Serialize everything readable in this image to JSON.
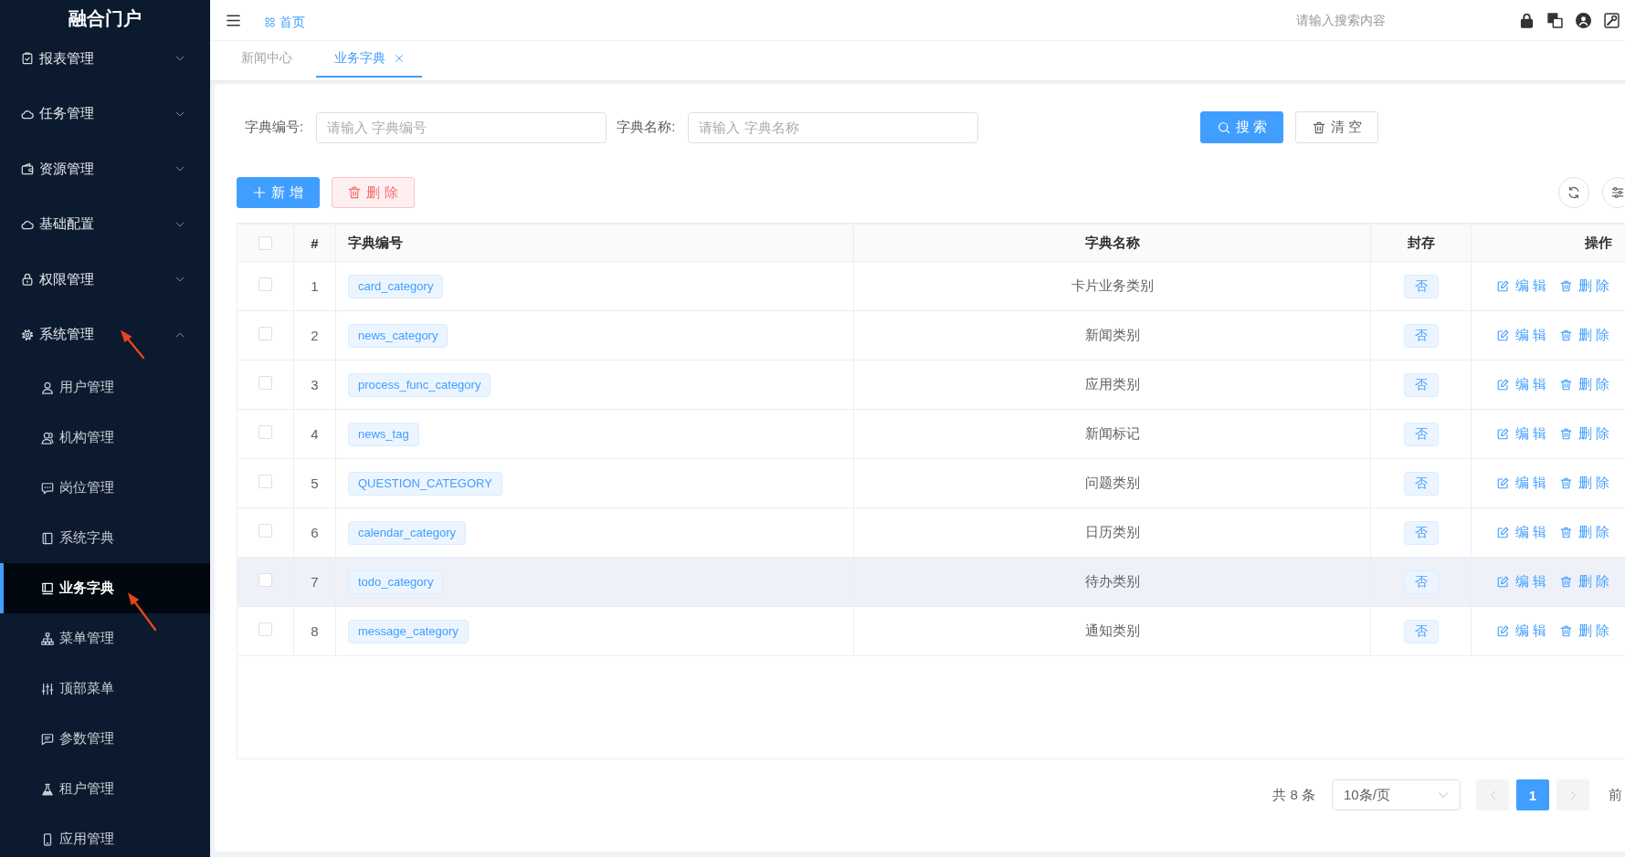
{
  "sidebar": {
    "title": "融合门户",
    "items": [
      {
        "label": "报表管理",
        "expanded": false
      },
      {
        "label": "任务管理",
        "expanded": false
      },
      {
        "label": "资源管理",
        "expanded": false
      },
      {
        "label": "基础配置",
        "expanded": false
      },
      {
        "label": "权限管理",
        "expanded": false
      },
      {
        "label": "系统管理",
        "expanded": true,
        "children": [
          {
            "label": "用户管理",
            "selected": false
          },
          {
            "label": "机构管理",
            "selected": false
          },
          {
            "label": "岗位管理",
            "selected": false
          },
          {
            "label": "系统字典",
            "selected": false
          },
          {
            "label": "业务字典",
            "selected": true
          },
          {
            "label": "菜单管理",
            "selected": false
          },
          {
            "label": "顶部菜单",
            "selected": false
          },
          {
            "label": "参数管理",
            "selected": false
          },
          {
            "label": "租户管理",
            "selected": false
          },
          {
            "label": "应用管理",
            "selected": false
          }
        ]
      }
    ]
  },
  "header": {
    "breadcrumb": "首页",
    "search": {
      "placeholder": "请输入搜索内容"
    }
  },
  "tabs": [
    {
      "label": "新闻中心",
      "selected": false,
      "closable": false
    },
    {
      "label": "业务字典",
      "selected": true,
      "closable": true
    }
  ],
  "filters": {
    "fields": [
      {
        "label": "字典编号:",
        "placeholder": "请输入 字典编号"
      },
      {
        "label": "字典名称:",
        "placeholder": "请输入 字典名称"
      }
    ],
    "buttons": [
      {
        "label": "搜 索",
        "kind": "primary"
      },
      {
        "label": "清 空",
        "kind": "plain"
      }
    ]
  },
  "toolbar": {
    "buttons": [
      {
        "label": "新 增",
        "kind": "primary"
      },
      {
        "label": "删 除",
        "kind": "danger"
      }
    ]
  },
  "table": {
    "select_all": {
      "checked": false
    },
    "columns": [
      "#",
      "字典编号",
      "字典名称",
      "封存",
      "操作"
    ],
    "rows": [
      {
        "checked": false,
        "highlighted": false,
        "index": "1",
        "code": "card_category",
        "name": "卡片业务类别",
        "sealed": "否",
        "actions": [
          {
            "label": "编 辑",
            "kind": "edit"
          },
          {
            "label": "删 除",
            "kind": "delete"
          }
        ]
      },
      {
        "checked": false,
        "highlighted": false,
        "index": "2",
        "code": "news_category",
        "name": "新闻类别",
        "sealed": "否",
        "actions": [
          {
            "label": "编 辑",
            "kind": "edit"
          },
          {
            "label": "删 除",
            "kind": "delete"
          }
        ]
      },
      {
        "checked": false,
        "highlighted": false,
        "index": "3",
        "code": "process_func_category",
        "name": "应用类别",
        "sealed": "否",
        "actions": [
          {
            "label": "编 辑",
            "kind": "edit"
          },
          {
            "label": "删 除",
            "kind": "delete"
          }
        ]
      },
      {
        "checked": false,
        "highlighted": false,
        "index": "4",
        "code": "news_tag",
        "name": "新闻标记",
        "sealed": "否",
        "actions": [
          {
            "label": "编 辑",
            "kind": "edit"
          },
          {
            "label": "删 除",
            "kind": "delete"
          }
        ]
      },
      {
        "checked": false,
        "highlighted": false,
        "index": "5",
        "code": "QUESTION_CATEGORY",
        "name": "问题类别",
        "sealed": "否",
        "actions": [
          {
            "label": "编 辑",
            "kind": "edit"
          },
          {
            "label": "删 除",
            "kind": "delete"
          }
        ]
      },
      {
        "checked": false,
        "highlighted": false,
        "index": "6",
        "code": "calendar_category",
        "name": "日历类别",
        "sealed": "否",
        "actions": [
          {
            "label": "编 辑",
            "kind": "edit"
          },
          {
            "label": "删 除",
            "kind": "delete"
          }
        ]
      },
      {
        "checked": false,
        "highlighted": true,
        "index": "7",
        "code": "todo_category",
        "name": "待办类别",
        "sealed": "否",
        "actions": [
          {
            "label": "编 辑",
            "kind": "edit"
          },
          {
            "label": "删 除",
            "kind": "delete"
          }
        ]
      },
      {
        "checked": false,
        "highlighted": false,
        "index": "8",
        "code": "message_category",
        "name": "通知类别",
        "sealed": "否",
        "actions": [
          {
            "label": "编 辑",
            "kind": "edit"
          },
          {
            "label": "删 除",
            "kind": "delete"
          }
        ]
      }
    ]
  },
  "pagination": {
    "total": "共 8 条",
    "page_size": "10条/页",
    "pages": [
      {
        "label": "1",
        "selected": true
      }
    ],
    "jump_label": "前"
  }
}
